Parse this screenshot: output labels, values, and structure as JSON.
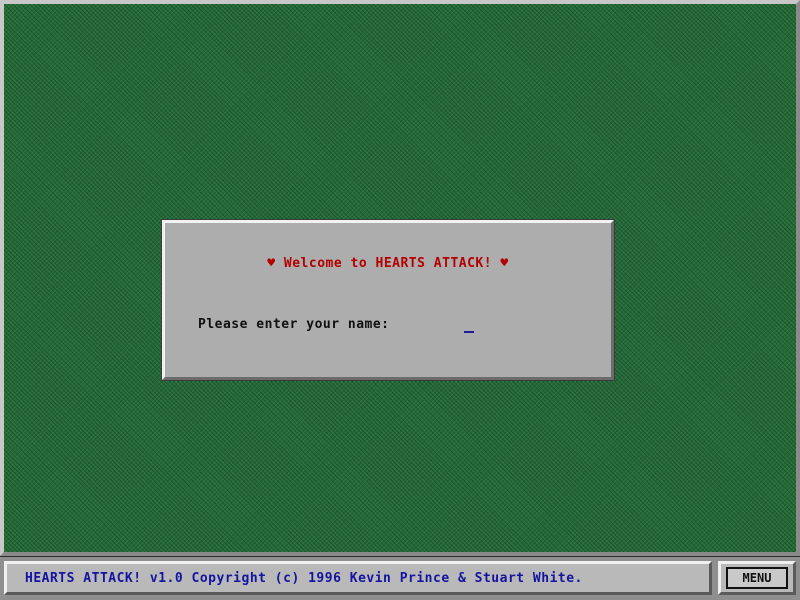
{
  "game": {
    "title": "HEARTS ATTACK!"
  },
  "dialog": {
    "heart_left": "♥",
    "welcome_text": "Welcome to HEARTS ATTACK!",
    "heart_right": "♥",
    "prompt_label": "Please enter your name:",
    "name_value": ""
  },
  "statusbar": {
    "copyright": "HEARTS ATTACK! v1.0 Copyright (c) 1996 Kevin Prince & Stuart White.",
    "menu_label": "MENU"
  },
  "colors": {
    "table_felt": "#226b36",
    "dialog_bg": "#adadad",
    "welcome_red": "#b40000",
    "copyright_blue": "#1414a0"
  }
}
